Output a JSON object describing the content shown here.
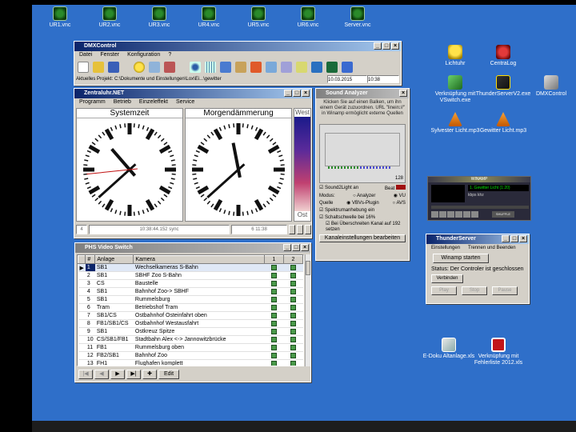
{
  "desktop_icons": [
    {
      "id": "ur1",
      "label": "UR1.vnc",
      "icon": "vnc-icon"
    },
    {
      "id": "ur2",
      "label": "UR2.vnc",
      "icon": "vnc-icon"
    },
    {
      "id": "ur3",
      "label": "UR3.vnc",
      "icon": "vnc-icon"
    },
    {
      "id": "ur4",
      "label": "UR4.vnc",
      "icon": "vnc-icon"
    },
    {
      "id": "ur5",
      "label": "UR5.vnc",
      "icon": "vnc-icon"
    },
    {
      "id": "ur6",
      "label": "UR6.vnc",
      "icon": "vnc-icon"
    },
    {
      "id": "server",
      "label": "Server.vnc",
      "icon": "vnc-icon"
    },
    {
      "id": "lichtuhr",
      "label": "Lichtuhr",
      "icon": "bulb-icon"
    },
    {
      "id": "centralog",
      "label": "CentraLog",
      "icon": "log-icon"
    },
    {
      "id": "vswitch",
      "label": "Verknüpfung mit VSwitch.exe",
      "icon": "switch-icon"
    },
    {
      "id": "thunderserver",
      "label": "ThunderServerV2.exe",
      "icon": "thunder-icon"
    },
    {
      "id": "dmxcontrol",
      "label": "DMXControl",
      "icon": "dmx-icon"
    },
    {
      "id": "sylvester",
      "label": "Sylvester Licht.mp3",
      "icon": "cone-icon"
    },
    {
      "id": "gewitter",
      "label": "Gewitter Licht.mp3",
      "icon": "cone-icon"
    },
    {
      "id": "edoku",
      "label": "E-Doku Altanlage.xls",
      "icon": "xls-icon"
    },
    {
      "id": "fehlerliste",
      "label": "Verknüpfung mit Fehlerliste 2012.xls",
      "icon": "pdf-icon"
    }
  ],
  "dmx": {
    "title": "DMXControl",
    "menu": [
      "Datei",
      "Fenster",
      "Konfiguration",
      "?"
    ],
    "status_project": "Aktuelles Projekt: C:\\Dokumente und Einstellungen\\Lox\\Ei...\\gewitter",
    "date": "10.03.2015",
    "time": "10:38"
  },
  "zentraluhr": {
    "title": "Zentraluhr.NET",
    "menu": [
      "Programm",
      "Betrieb",
      "Einzeleffekt",
      "Service"
    ],
    "clock1_label": "Systemzeit",
    "clock2_label": "Morgendämmerung",
    "scale_top": "West",
    "scale_bottom": "Ost",
    "status_left": "4",
    "status_mid": "10:38:44.152",
    "status_mid2": "sync",
    "status_right": "6 11:38",
    "clock1": {
      "h": 10,
      "m": 38,
      "s": 44
    },
    "clock2": {
      "h": 11,
      "m": 38,
      "s": null
    }
  },
  "sound": {
    "title": "Sound Analyzer",
    "desc": "Klicken Sie auf einen Balken, um ihn einem Gerät zuzuordnen. URL \"linein://\" in Winamp ermöglicht externe Quellen",
    "scale_val": "128",
    "s2l_label": "Sound2Light an",
    "beat_label": "Beat",
    "modus_label": "Modus:",
    "quelle_label": "Quelle",
    "opt_analyzer": "Analyzer",
    "opt_vu": "VU",
    "opt_vbvs": "VBVs-Plugin",
    "opt_avs": "AVS",
    "spektrum_label": "Spektrumanhebung ein",
    "schalt_label": "Schaltschwelle bei 16%",
    "ueber_label": "Bei Überschreiten Kanal auf 192 setzen",
    "kanal_btn": "Kanaleinstellungen bearbeiten"
  },
  "winamp": {
    "title": "WINAMP",
    "track": "1. Gewitter Licht (1:20)",
    "kbps": "kbps",
    "khz": "khz",
    "shuffle": "SHUFFLE"
  },
  "thunder": {
    "title": "ThunderServer",
    "menu": [
      "Einstellungen",
      "Trennen und Beenden"
    ],
    "start_btn": "Winamp starten",
    "status": "Status:  Der Controler ist geschlossen",
    "connect_btn": "Verbinden",
    "play_btn": "Play",
    "stop_btn": "Stop",
    "pause_btn": "Pause"
  },
  "video": {
    "title": "PHS Video Switch",
    "columns": [
      "#",
      "Anlage",
      "Kamera",
      "1",
      "2"
    ],
    "rows": [
      {
        "n": "1",
        "anlage": "SB1",
        "kamera": "Wechselkameras S-Bahn"
      },
      {
        "n": "2",
        "anlage": "SB1",
        "kamera": "SBHF Zoo S-Bahn"
      },
      {
        "n": "3",
        "anlage": "CS",
        "kamera": "Baustelle"
      },
      {
        "n": "4",
        "anlage": "SB1",
        "kamera": "Bahnhof Zoo-> SBHF"
      },
      {
        "n": "5",
        "anlage": "SB1",
        "kamera": "Rummelsburg"
      },
      {
        "n": "6",
        "anlage": "Tram",
        "kamera": "Betriebshof Tram"
      },
      {
        "n": "7",
        "anlage": "SB1/CS",
        "kamera": "Ostbahnhof Osteinfahrt oben"
      },
      {
        "n": "8",
        "anlage": "FB1/SB1/CS",
        "kamera": "Ostbahnhof Westausfahrt"
      },
      {
        "n": "9",
        "anlage": "SB1",
        "kamera": "Ostkreuz Spitze"
      },
      {
        "n": "10",
        "anlage": "CS/SB1/FB1",
        "kamera": "Stadtbahn Alex <-> Jannowitzbrücke"
      },
      {
        "n": "11",
        "anlage": "FB1",
        "kamera": "Rummelsburg oben"
      },
      {
        "n": "12",
        "anlage": "FB2/SB1",
        "kamera": "Bahnhof Zoo"
      },
      {
        "n": "13",
        "anlage": "FH1",
        "kamera": "Flughafen komplett"
      }
    ],
    "nav": [
      "|◀",
      "◀",
      "▶",
      "▶|",
      "✚"
    ],
    "edit_btn": "Edit"
  }
}
